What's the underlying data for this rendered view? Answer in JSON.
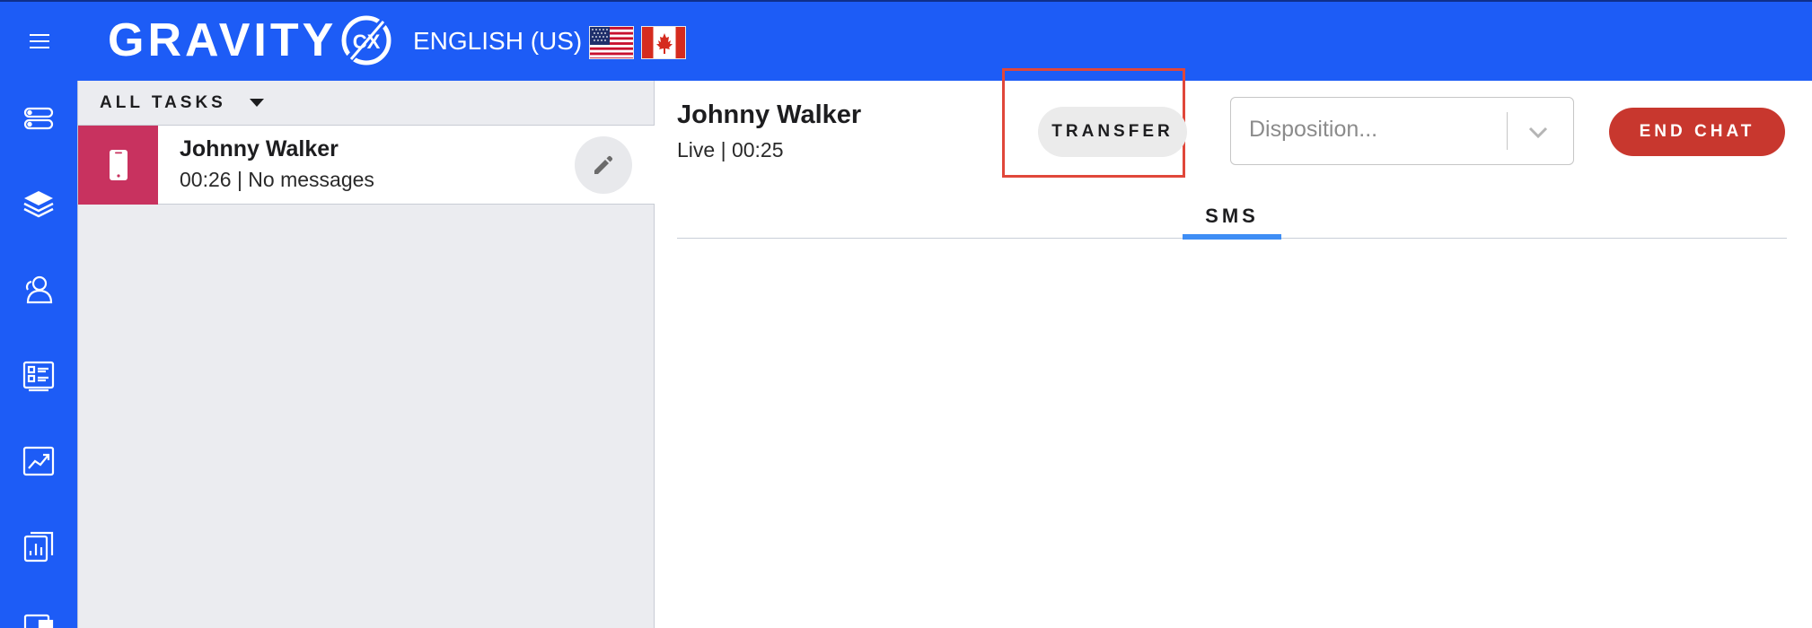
{
  "header": {
    "logo_text": "GRAVITY",
    "logo_suffix": "CX",
    "language": "ENGLISH (US)",
    "flags": [
      "us-flag-icon",
      "canada-flag-icon"
    ]
  },
  "rail": {
    "icons": [
      "task-toggle-icon",
      "layers-icon",
      "contacts-icon",
      "forms-icon",
      "analytics-icon",
      "reports-icon"
    ]
  },
  "tasks": {
    "header_label": "ALL TASKS",
    "items": [
      {
        "name": "Johnny Walker",
        "meta": "00:26 | No messages",
        "channel_icon": "mobile-phone-icon"
      }
    ]
  },
  "conversation": {
    "contact_name": "Johnny Walker",
    "status": "Live | 00:25",
    "transfer_label": "TRANSFER",
    "disposition_placeholder": "Disposition...",
    "end_chat_label": "END CHAT",
    "tabs": [
      {
        "label": "SMS",
        "active": true
      }
    ]
  },
  "colors": {
    "brand_blue": "#1d5cf6",
    "task_stripe": "#c8325f",
    "end_chat": "#c8372e",
    "highlight": "#e0473a",
    "tab_underline": "#3f8ef5"
  }
}
